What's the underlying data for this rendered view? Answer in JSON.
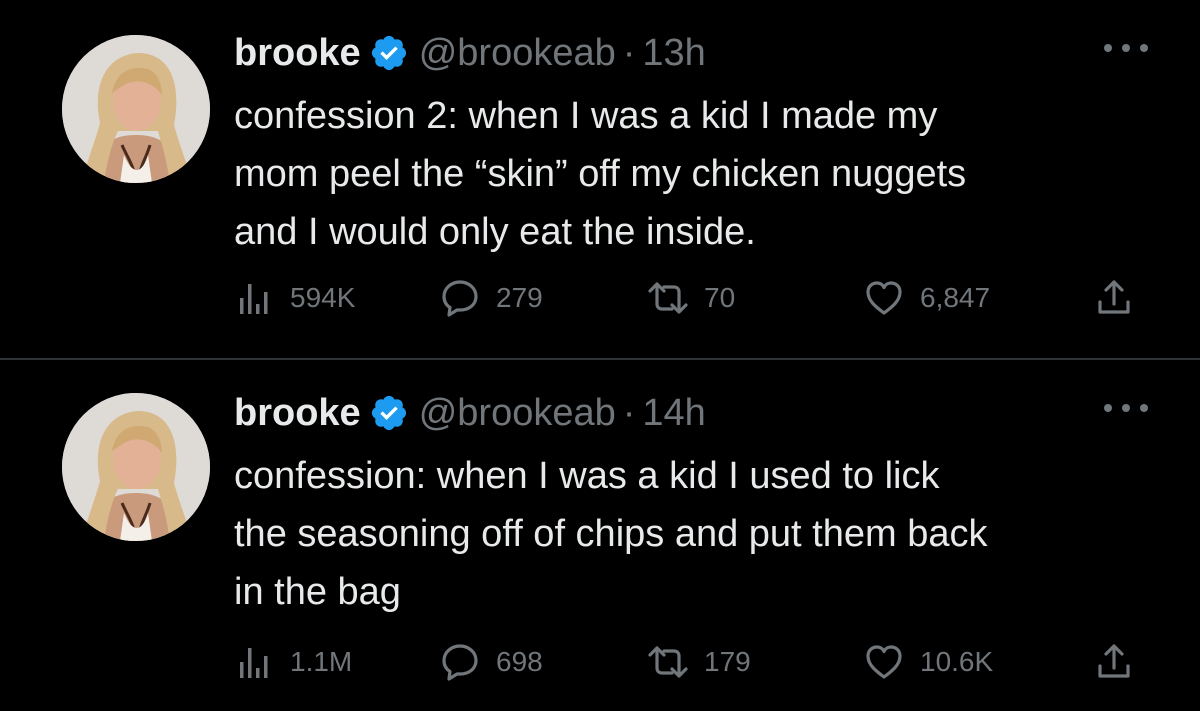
{
  "tweets": [
    {
      "name": "brooke",
      "handle": "@brookeab",
      "separator": "·",
      "time": "13h",
      "text": "confession 2: when I was a kid I made my\nmom peel the “skin” off my chicken nuggets\nand I would only eat the inside.",
      "views": "594K",
      "replies": "279",
      "retweets": "70",
      "likes": "6,847"
    },
    {
      "name": "brooke",
      "handle": "@brookeab",
      "separator": "·",
      "time": "14h",
      "text": "confession: when I was a kid I used to lick\nthe seasoning off of chips and put them back\nin the bag",
      "views": "1.1M",
      "replies": "698",
      "retweets": "179",
      "likes": "10.6K"
    }
  ],
  "colors": {
    "background": "#000000",
    "text": "#e7e9ea",
    "secondary": "#71767b",
    "verified": "#1d9bf0",
    "divider": "#2f3336"
  },
  "icons": [
    "views-icon",
    "reply-icon",
    "retweet-icon",
    "like-icon",
    "share-icon",
    "more-icon",
    "verified-badge-icon"
  ]
}
